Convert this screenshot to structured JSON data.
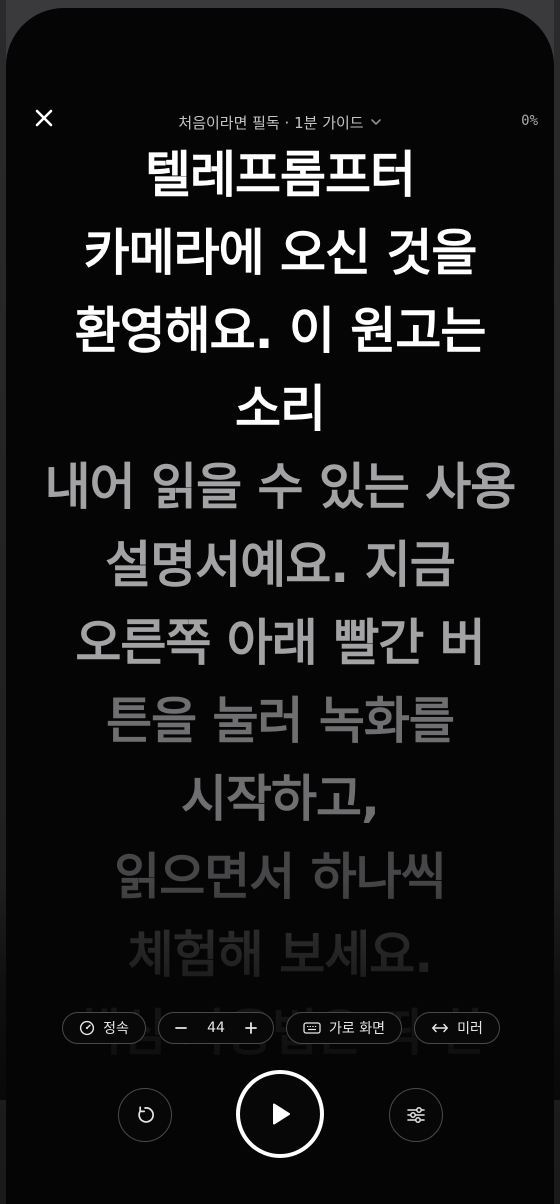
{
  "header": {
    "close_icon": "close-icon",
    "title": "처음이라면 필독 · 1분 가이드",
    "title_icon": "chevron-down-icon",
    "progress": "0%"
  },
  "script": {
    "lines": [
      {
        "text": "텔레프롬프터",
        "color": "#ffffff"
      },
      {
        "text": "카메라에 오신 것을",
        "color": "#ffffff"
      },
      {
        "text": "환영해요. 이 원고는",
        "color": "#ffffff"
      },
      {
        "text": "소리",
        "color": "#ffffff"
      },
      {
        "text": "내어 읽을 수 있는 사용",
        "color": "#a3a3a5"
      },
      {
        "text": "설명서예요. 지금",
        "color": "#a3a3a5"
      },
      {
        "text": "오른쪽 아래 빨간 버",
        "color": "#a3a3a5"
      },
      {
        "text": "튼을 눌러 녹화를",
        "color": "#6f6f71"
      },
      {
        "text": "시작하고,",
        "color": "#6f6f71"
      },
      {
        "text": "읽으면서 하나씩",
        "color": "#464648"
      },
      {
        "text": "체험해 보세요.",
        "color": "#3a3a3c"
      },
      {
        "text": "핵심 사용법은 딱 한",
        "color": "#2e2e30"
      }
    ]
  },
  "controls": {
    "speed": {
      "label": "정속",
      "icon": "gauge-icon"
    },
    "font_size": {
      "decrease": "−",
      "value": "44",
      "increase": "+"
    },
    "landscape": {
      "label": "가로 화면",
      "icon": "keyboard-landscape-icon"
    },
    "mirror": {
      "label": "미러",
      "icon": "mirror-arrows-icon"
    },
    "restart_icon": "restart-icon",
    "play_icon": "play-icon",
    "settings_icon": "sliders-icon"
  },
  "colors": {
    "background": "#050505",
    "text_active": "#ffffff",
    "text_upcoming": "#a3a3a5",
    "accent_border": "#ffffff"
  }
}
